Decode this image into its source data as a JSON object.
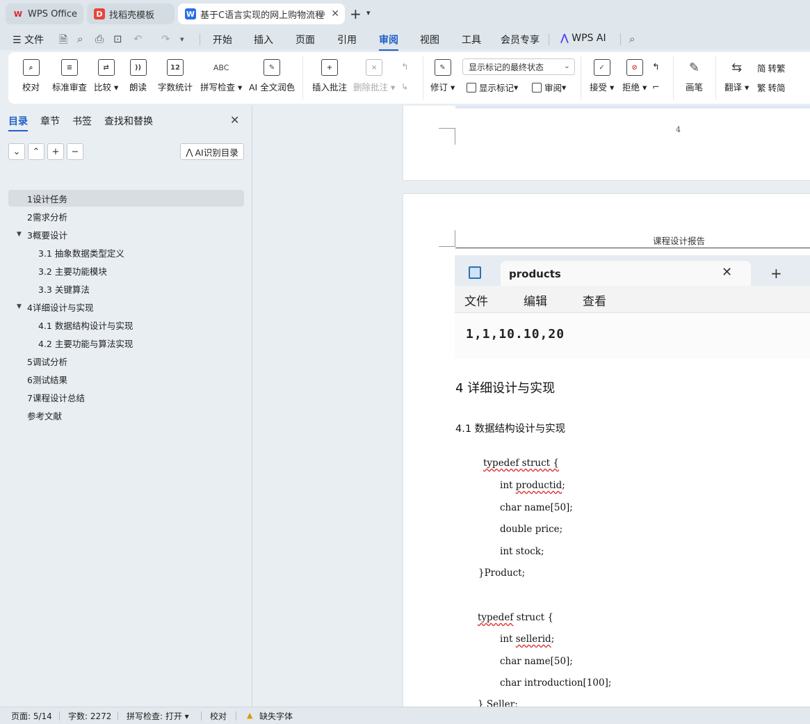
{
  "tabs": [
    {
      "label": "WPS Office",
      "logo": "W"
    },
    {
      "label": "找稻壳模板",
      "logo": "D"
    },
    {
      "label": "基于C语言实现的网上购物流程",
      "logo": "W"
    }
  ],
  "menu": {
    "file": "文件",
    "items": [
      "开始",
      "插入",
      "页面",
      "引用",
      "审阅",
      "视图",
      "工具",
      "会员专享"
    ],
    "active": "审阅",
    "ai": "WPS AI"
  },
  "ribbon": {
    "proofread": "校对",
    "std_review": "标准审查",
    "compare": "比较",
    "read_aloud": "朗读",
    "word_count": "字数统计",
    "word_count_icon": "12",
    "spell_check": "拼写检查",
    "spell_icon": "ABC",
    "ai_polish": "AI 全文润色",
    "insert_comment": "插入批注",
    "delete_comment": "删除批注",
    "track_changes": "修订",
    "markup_state": "显示标记的最终状态",
    "show_markup": "显示标记",
    "review": "审阅",
    "accept": "接受",
    "reject": "拒绝",
    "pen": "画笔",
    "translate": "翻译",
    "to_traditional": "转繁",
    "to_simplified": "转简"
  },
  "nav": {
    "tabs": [
      "目录",
      "章节",
      "书签",
      "查找和替换"
    ],
    "active_tab": "目录",
    "ai_toc": "AI识别目录",
    "toc": [
      {
        "label": "1设计任务",
        "level": 1
      },
      {
        "label": "2需求分析",
        "level": 1
      },
      {
        "label": "3概要设计",
        "level": 1
      },
      {
        "label": "3.1 抽象数据类型定义",
        "level": 2
      },
      {
        "label": "3.2  主要功能模块",
        "level": 2
      },
      {
        "label": "3.3  关键算法",
        "level": 2
      },
      {
        "label": "4详细设计与实现",
        "level": 1
      },
      {
        "label": "4.1  数据结构设计与实现",
        "level": 2
      },
      {
        "label": "4.2  主要功能与算法实现",
        "level": 2
      },
      {
        "label": "5调试分析",
        "level": 1
      },
      {
        "label": "6测试结果",
        "level": 1
      },
      {
        "label": "7课程设计总结",
        "level": 1
      },
      {
        "label": "参考文献",
        "level": 1
      }
    ],
    "selected": "1设计任务"
  },
  "document": {
    "prev_page_number": "4",
    "header": "课程设计报告",
    "notepad": {
      "tab_title": "products",
      "menu": [
        "文件",
        "编辑",
        "查看"
      ],
      "content": "1,1,10.10,20"
    },
    "heading1": "4  详细设计与实现",
    "heading2": "4.1  数据结构设计与实现",
    "code": {
      "l1": "typedef struct {",
      "l2a": "int ",
      "l2b": "productid",
      "l2c": ";",
      "l3": "char name[50];",
      "l4": "double price;",
      "l5": "int stock;",
      "l6": "}Product;",
      "l7a": "typedef",
      "l7b": " struct {",
      "l8a": "int ",
      "l8b": "sellerid",
      "l8c": ";",
      "l9": "char name[50];",
      "l10": "char introduction[100];",
      "l11": "} Seller;"
    }
  },
  "status": {
    "page": "页面: 5/14",
    "words": "字数: 2272",
    "spell": "拼写检查: 打开",
    "proofread": "校对",
    "missing_font": "缺失字体"
  }
}
